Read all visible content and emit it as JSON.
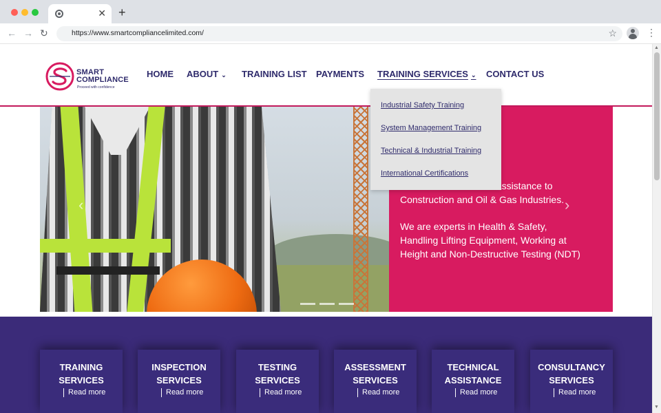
{
  "browser": {
    "url": "https://www.smartcompliancelimited.com/",
    "tab_close": "✕",
    "new_tab": "+"
  },
  "site": {
    "logo": {
      "name_line1": "SMART",
      "name_line2": "COMPLIANCE",
      "tagline": "Proceed with confidence"
    },
    "nav": [
      {
        "label": "HOME"
      },
      {
        "label": "ABOUT",
        "has_chevron": true
      },
      {
        "label": "TRAINING LIST"
      },
      {
        "label": "PAYMENTS"
      },
      {
        "label": "TRAINING SERVICES",
        "has_chevron": true,
        "active": true
      },
      {
        "label": "CONTACT US"
      }
    ],
    "dropdown": [
      "Industrial Safety Training",
      "System Management Training",
      "Technical & Industrial Training",
      "International Certifications"
    ],
    "hero": {
      "line1_visible": "al assistance to",
      "line2": "Construction and Oil & Gas Industries.",
      "para2_line1": "We are experts in Health & Safety,",
      "para2_line2": "Handling Lifting Equipment, Working at",
      "para2_line3": "Height and Non-Destructive Testing (NDT)"
    },
    "services": [
      {
        "title_1": "TRAINING",
        "title_2": "SERVICES",
        "link": "Read more"
      },
      {
        "title_1": "INSPECTION",
        "title_2": "SERVICES",
        "link": "Read more"
      },
      {
        "title_1": "TESTING",
        "title_2": "SERVICES",
        "link": "Read more"
      },
      {
        "title_1": "ASSESSMENT",
        "title_2": "SERVICES",
        "link": "Read more"
      },
      {
        "title_1": "TECHNICAL",
        "title_2": "ASSISTANCE",
        "link": "Read more"
      },
      {
        "title_1": "CONSULTANCY",
        "title_2": "SERVICES",
        "link": "Read more"
      }
    ]
  },
  "colors": {
    "brand_purple": "#2e2a6b",
    "brand_magenta": "#d81b60",
    "services_band": "#3b2b79"
  }
}
